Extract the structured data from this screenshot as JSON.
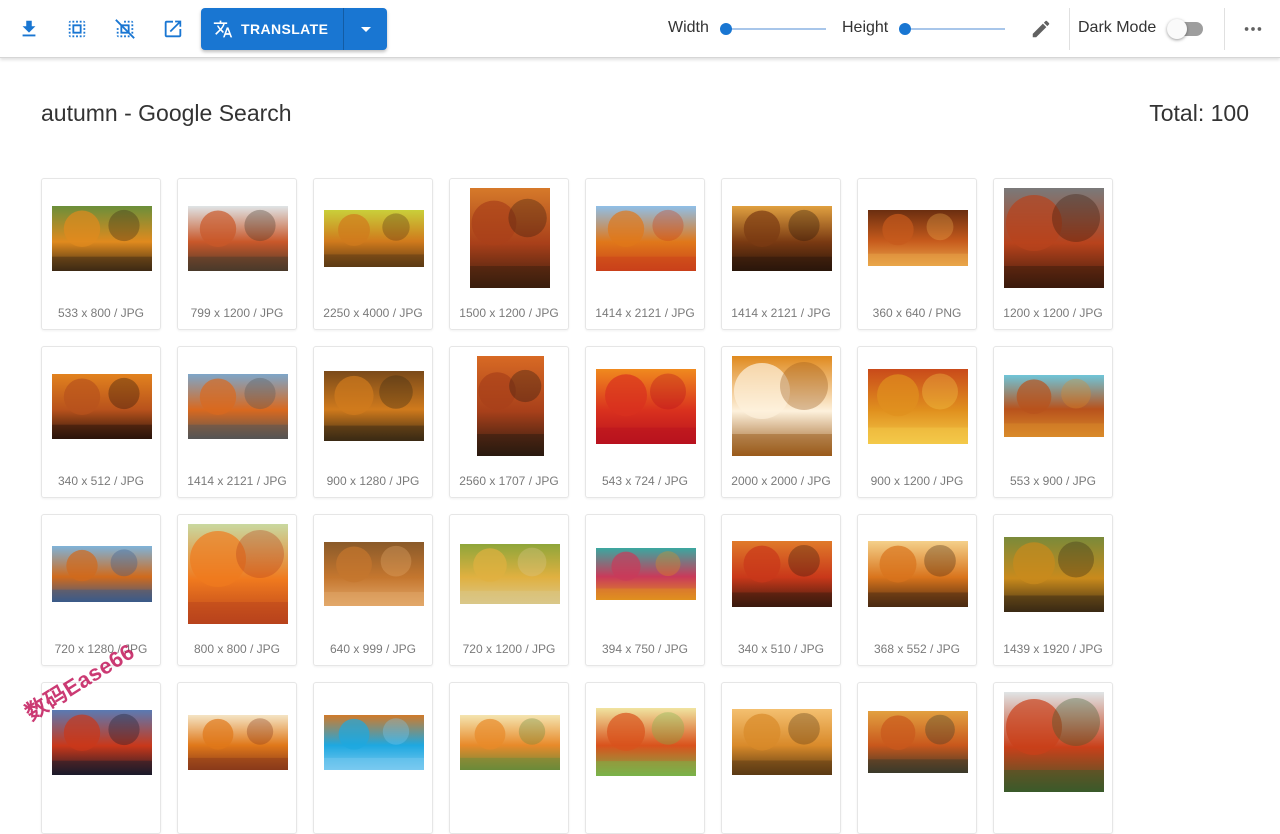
{
  "toolbar": {
    "translate_label": "TRANSLATE",
    "width_label": "Width",
    "width_value": 0,
    "height_label": "Height",
    "height_value": 0,
    "dark_mode_label": "Dark Mode",
    "dark_mode_on": false,
    "accent_color": "#1976d2"
  },
  "page": {
    "title": "autumn - Google Search",
    "total": "Total: 100"
  },
  "images": [
    {
      "caption": "533 x 800 / JPG",
      "ar": 0.65,
      "c1": "#e08a1e",
      "c2": "#6b8f3a",
      "c3": "#3d2a14"
    },
    {
      "caption": "799 x 1200 / JPG",
      "ar": 0.65,
      "c1": "#c9582a",
      "c2": "#dfe4e6",
      "c3": "#4a3a2a"
    },
    {
      "caption": "2250 x 4000 / JPG",
      "ar": 0.57,
      "c1": "#d07a1c",
      "c2": "#c9cf3a",
      "c3": "#5c3a15"
    },
    {
      "caption": "1500 x 1200 / JPG",
      "ar": 1.25,
      "c1": "#a9401a",
      "c2": "#d67a2a",
      "c3": "#3a1e0e"
    },
    {
      "caption": "1414 x 2121 / JPG",
      "ar": 0.65,
      "c1": "#e0781a",
      "c2": "#8fbfe8",
      "c3": "#c9401a"
    },
    {
      "caption": "1414 x 2121 / JPG",
      "ar": 0.65,
      "c1": "#7a3a12",
      "c2": "#e0a040",
      "c3": "#2a160a"
    },
    {
      "caption": "360 x 640 / PNG",
      "ar": 0.56,
      "c1": "#c65a1c",
      "c2": "#6b2e10",
      "c3": "#e9a64a"
    },
    {
      "caption": "1200 x 1200 / JPG",
      "ar": 1.0,
      "c1": "#b8431c",
      "c2": "#7a7a7a",
      "c3": "#3a1a0c"
    },
    {
      "caption": "340 x 512 / JPG",
      "ar": 0.65,
      "c1": "#b8521c",
      "c2": "#e2821e",
      "c3": "#2a140a"
    },
    {
      "caption": "1414 x 2121 / JPG",
      "ar": 0.65,
      "c1": "#d9691f",
      "c2": "#7ea6c9",
      "c3": "#555555"
    },
    {
      "caption": "900 x 1280 / JPG",
      "ar": 0.7,
      "c1": "#d07a1c",
      "c2": "#7a4a1a",
      "c3": "#3a2a14"
    },
    {
      "caption": "2560 x 1707 / JPG",
      "ar": 1.5,
      "c1": "#a8401a",
      "c2": "#d86a24",
      "c3": "#2a1a10"
    },
    {
      "caption": "543 x 724 / JPG",
      "ar": 0.75,
      "c1": "#d9311e",
      "c2": "#f08a1e",
      "c3": "#b8121e"
    },
    {
      "caption": "2000 x 2000 / JPG",
      "ar": 1.0,
      "c1": "#fdf1dc",
      "c2": "#e08a1e",
      "c3": "#9a5a1a"
    },
    {
      "caption": "900 x 1200 / JPG",
      "ar": 0.75,
      "c1": "#e0901e",
      "c2": "#c94a1a",
      "c3": "#f4c94a"
    },
    {
      "caption": "553 x 900 / JPG",
      "ar": 0.62,
      "c1": "#b8521c",
      "c2": "#6fc5d9",
      "c3": "#d98a2a"
    },
    {
      "caption": "720 x 1280 / JPG",
      "ar": 0.56,
      "c1": "#d06a1c",
      "c2": "#7fb3d9",
      "c3": "#3a5a8a"
    },
    {
      "caption": "800 x 800 / JPG",
      "ar": 1.0,
      "c1": "#f07a1e",
      "c2": "#c9d9a0",
      "c3": "#b8421c"
    },
    {
      "caption": "640 x 999 / JPG",
      "ar": 0.64,
      "c1": "#c4762e",
      "c2": "#8a5a2a",
      "c3": "#e2a86a"
    },
    {
      "caption": "720 x 1200 / JPG",
      "ar": 0.6,
      "c1": "#e0b040",
      "c2": "#8fa63a",
      "c3": "#d9c78a"
    },
    {
      "caption": "394 x 750 / JPG",
      "ar": 0.52,
      "c1": "#c93a5a",
      "c2": "#3aa8a0",
      "c3": "#e0901e"
    },
    {
      "caption": "340 x 510 / JPG",
      "ar": 0.66,
      "c1": "#c9381a",
      "c2": "#e07a2a",
      "c3": "#3a1a0e"
    },
    {
      "caption": "368 x 552 / JPG",
      "ar": 0.66,
      "c1": "#d9741c",
      "c2": "#f4d08a",
      "c3": "#4a2a12"
    },
    {
      "caption": "1439 x 1920 / JPG",
      "ar": 0.75,
      "c1": "#c98a1c",
      "c2": "#7a8a3a",
      "c3": "#3a2a14"
    },
    {
      "caption": "",
      "ar": 0.65,
      "c1": "#c9381a",
      "c2": "#5a7ab3",
      "c3": "#1a1a2a"
    },
    {
      "caption": "",
      "ar": 0.55,
      "c1": "#e0781a",
      "c2": "#f4e4c4",
      "c3": "#8a3a1a"
    },
    {
      "caption": "",
      "ar": 0.55,
      "c1": "#1ea8e0",
      "c2": "#d07a2a",
      "c3": "#7ac9f0"
    },
    {
      "caption": "",
      "ar": 0.55,
      "c1": "#e88a2a",
      "c2": "#f4e4b0",
      "c3": "#6a8a3a"
    },
    {
      "caption": "",
      "ar": 0.68,
      "c1": "#d9521c",
      "c2": "#f0e4a0",
      "c3": "#7ab34a"
    },
    {
      "caption": "",
      "ar": 0.66,
      "c1": "#d98a2a",
      "c2": "#f4c070",
      "c3": "#5a3a14"
    },
    {
      "caption": "",
      "ar": 0.62,
      "c1": "#c9581c",
      "c2": "#e2a040",
      "c3": "#3a3a2a"
    },
    {
      "caption": "",
      "ar": 1.0,
      "c1": "#c9401a",
      "c2": "#e0e4e6",
      "c3": "#3a5a2a"
    }
  ],
  "watermark": "数码Ease66"
}
